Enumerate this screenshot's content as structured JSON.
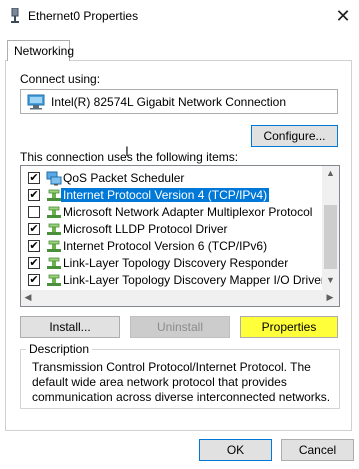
{
  "window": {
    "title": "Ethernet0 Properties",
    "close_glyph": "✕"
  },
  "tabs": [
    {
      "label": "Networking",
      "active": true
    }
  ],
  "connect_using": {
    "label": "Connect using:",
    "adapter": "Intel(R) 82574L Gigabit Network Connection",
    "configure_button": "Configure..."
  },
  "items_section": {
    "label": "This connection uses the following items:",
    "items": [
      {
        "label": "QoS Packet Scheduler",
        "checked": true,
        "icon": "network-service-icon",
        "selected": false
      },
      {
        "label": "Internet Protocol Version 4 (TCP/IPv4)",
        "checked": true,
        "icon": "network-protocol-icon",
        "selected": true
      },
      {
        "label": "Microsoft Network Adapter Multiplexor Protocol",
        "checked": false,
        "icon": "network-protocol-icon",
        "selected": false
      },
      {
        "label": "Microsoft LLDP Protocol Driver",
        "checked": true,
        "icon": "network-protocol-icon",
        "selected": false
      },
      {
        "label": "Internet Protocol Version 6 (TCP/IPv6)",
        "checked": true,
        "icon": "network-protocol-icon",
        "selected": false
      },
      {
        "label": "Link-Layer Topology Discovery Responder",
        "checked": true,
        "icon": "network-protocol-icon",
        "selected": false
      },
      {
        "label": "Link-Layer Topology Discovery Mapper I/O Driver",
        "checked": true,
        "icon": "network-protocol-icon",
        "selected": false
      }
    ]
  },
  "actions": {
    "install": "Install...",
    "uninstall": "Uninstall",
    "properties": "Properties"
  },
  "description": {
    "title": "Description",
    "text": "Transmission Control Protocol/Internet Protocol. The default wide area network protocol that provides communication across diverse interconnected networks."
  },
  "footer": {
    "ok": "OK",
    "cancel": "Cancel"
  },
  "colors": {
    "selection": "#0078d7",
    "highlight_yellow": "#ffff3a",
    "button_face": "#e1e1e1"
  }
}
